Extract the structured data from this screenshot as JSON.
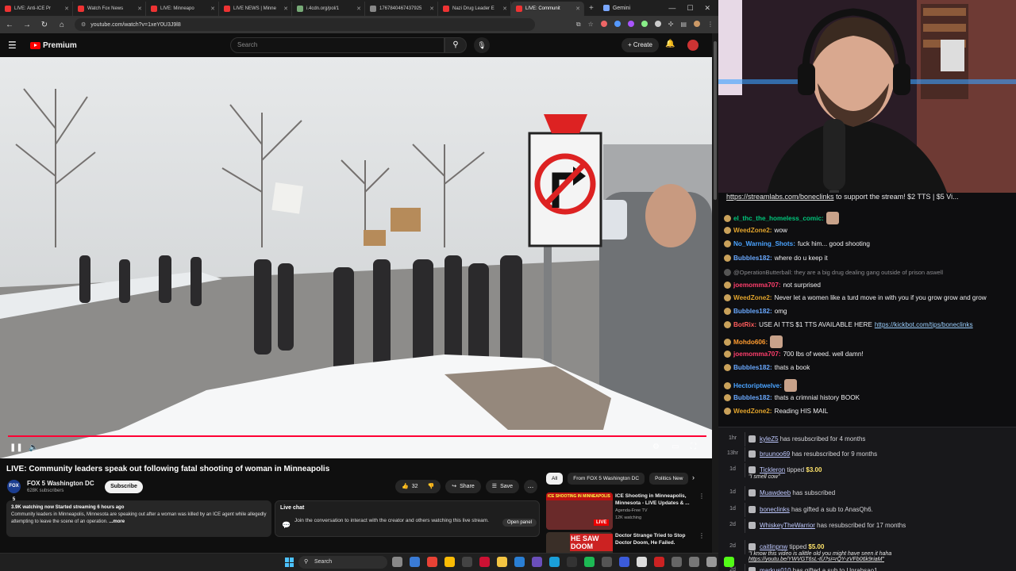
{
  "browser": {
    "tabs": [
      {
        "label": "LIVE: Anti-ICE Pr",
        "color": "#e33"
      },
      {
        "label": "Watch Fox News",
        "color": "#e33"
      },
      {
        "label": "LIVE: Minneapo",
        "color": "#e33"
      },
      {
        "label": "LIVE NEWS | Minne",
        "color": "#e33"
      },
      {
        "label": "i.4cdn.org/pol/1",
        "color": "#7a7"
      },
      {
        "label": "1767840467437925",
        "color": "#888"
      },
      {
        "label": "Nazi Drug Leader E",
        "color": "#e33"
      },
      {
        "label": "LIVE: Communit",
        "color": "#e33",
        "active": true
      },
      {
        "label": "Gemini",
        "color": "#7aa7ff"
      }
    ],
    "url": "youtube.com/watch?v=1xeY0U3J9l8"
  },
  "youtube": {
    "logo_text": "Premium",
    "search_placeholder": "Search",
    "create_label": "+ Create",
    "video_title": "LIVE: Community leaders speak out following fatal shooting of woman in Minneapolis",
    "channel": {
      "name": "FOX 5 Washington DC",
      "avatar_text": "FOX 5",
      "subs": "628K subscribers"
    },
    "subscribe_label": "Subscribe",
    "actions": {
      "likes": "32",
      "share": "Share",
      "save": "Save",
      "more": "..."
    },
    "description": {
      "stats": "3.9K watching now  Started streaming 6 hours ago",
      "text": "Community leaders in Minneapolis, Minnesota are speaking out after a woman was killed by an ICE agent while allegedly attempting to leave the scene of an operation.",
      "more": "...more"
    },
    "live_chat": {
      "title": "Live chat",
      "text": "Join the conversation to interact with the creator and others watching this live stream.",
      "button": "Open panel"
    },
    "chips": [
      "All",
      "From FOX 5 Washington DC",
      "Politics New"
    ],
    "recommendations": [
      {
        "title": "ICE Shooting in Minneapolis, Minnesota - LIVE Updates & ...",
        "channel": "Agenda-Free TV",
        "views": "12K watching",
        "thumb_text": "ICE SHOOTING IN MINNEAPOLIS",
        "badge": "LIVE"
      },
      {
        "title": "Doctor Strange Tried to Stop Doctor Doom, He Failed.",
        "channel": "",
        "views": "",
        "thumb_text": "HE SAW DOOM"
      }
    ]
  },
  "stream": {
    "banner_link": "https://streamlabs.com/boneclinks",
    "banner_text": " to support the stream! $2 TTS | $5 Vi..."
  },
  "chat": [
    {
      "user": "el_thc_the_homeless_comic:",
      "color": "#00c47a",
      "text": "",
      "sticker": true
    },
    {
      "user": "WeedZone2:",
      "color": "#e0a32c",
      "text": "wow"
    },
    {
      "user": "No_Warning_Shots:",
      "color": "#4aa3ff",
      "text": "fuck him... good shooting"
    },
    {
      "user": "Bubbles182:",
      "color": "#6aa9ff",
      "text": "where do u keep it"
    },
    {
      "user": "",
      "color": "#8b8b8f",
      "text": "@OperationButterball: they are a big drug dealing gang outside of prison aswell",
      "faded": true
    },
    {
      "user": "joemomma707:",
      "color": "#ff3e6c",
      "text": "not surprised"
    },
    {
      "user": "WeedZone2:",
      "color": "#e0a32c",
      "text": "Never let a women like a turd move in with you if you grow grow and grow"
    },
    {
      "user": "Bubbles182:",
      "color": "#6aa9ff",
      "text": "omg"
    },
    {
      "user": "BotRix:",
      "color": "#ff5c5c",
      "text": "USE AI TTS $1 TTS AVAILABLE HERE ",
      "link": "https://kickbot.com/tips/boneclinks"
    },
    {
      "user": "Mohdo606:",
      "color": "#ff9b2f",
      "text": "",
      "sticker": true
    },
    {
      "user": "joemomma707:",
      "color": "#ff3e6c",
      "text": "700 lbs of weed. well damn!"
    },
    {
      "user": "Bubbles182:",
      "color": "#6aa9ff",
      "text": "thats a book"
    },
    {
      "user": "Hectoriptwelve:",
      "color": "#4aa3ff",
      "text": "",
      "sticker": true
    },
    {
      "user": "Bubbles182:",
      "color": "#6aa9ff",
      "text": "thats a crimnial history BOOK"
    },
    {
      "user": "WeedZone2:",
      "color": "#e0a32c",
      "text": "Reading HIS MAIL"
    }
  ],
  "events": [
    {
      "time": "1hr",
      "name": "kyleZ5",
      "text": " has resubscribed for 4 months"
    },
    {
      "time": "13hr",
      "name": "bruunoo69",
      "text": " has resubscribed for 9 months"
    },
    {
      "time": "1d",
      "name": "Tickleron",
      "text": " tipped ",
      "amount": "$3.00",
      "note": "\"I smell cow\""
    },
    {
      "time": "1d",
      "name": "Muawdeeb",
      "text": " has subscribed"
    },
    {
      "time": "1d",
      "name": "boneclinks",
      "text": " has gifted a sub to AnasQh6."
    },
    {
      "time": "2d",
      "name": "WhiskeyTheWarrior",
      "text": " has resubscribed for 17 months"
    },
    {
      "time": "2d",
      "name": "caitlinpnw",
      "text": " tipped ",
      "amount": "$5.00",
      "note": "\"I know this video is alittle old you might have seen it haha",
      "note2": "https://youtu.be/YWVGT6sL-tU?si=rQY-zVFb06k9riaM\""
    },
    {
      "time": "2d",
      "name": "markus010",
      "text": " has gifted a sub to Unrabsao1"
    }
  ],
  "taskbar": {
    "search": "Search"
  }
}
